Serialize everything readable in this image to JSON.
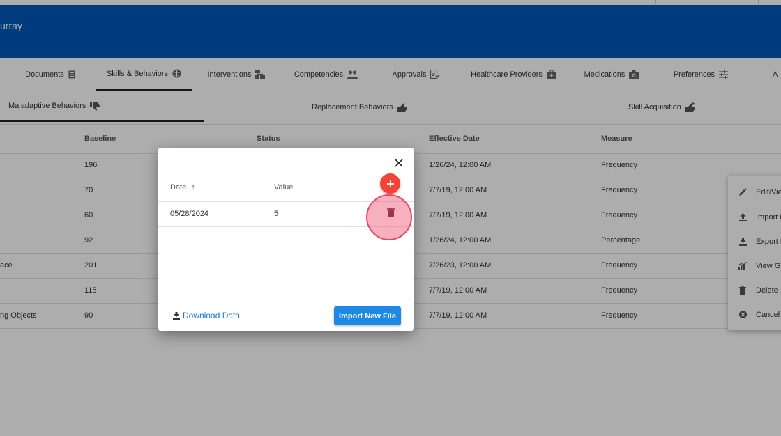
{
  "header": {
    "title": "urray",
    "color": "#0057b8"
  },
  "tabs": [
    {
      "label": "Documents",
      "icon": "document-icon"
    },
    {
      "label": "Skills & Behaviors",
      "icon": "brain-icon"
    },
    {
      "label": "Interventions",
      "icon": "hierarchy-icon"
    },
    {
      "label": "Competencies",
      "icon": "people-icon"
    },
    {
      "label": "Approvals",
      "icon": "checklist-icon"
    },
    {
      "label": "Healthcare Providers",
      "icon": "medkit-icon"
    },
    {
      "label": "Medications",
      "icon": "medical-bag-icon"
    },
    {
      "label": "Preferences",
      "icon": "sliders-icon"
    },
    {
      "label": "A",
      "icon": ""
    }
  ],
  "subtabs": [
    {
      "label": "Maladaptive Behaviors",
      "icon": "thumbs-down-icon"
    },
    {
      "label": "Replacement Behaviors",
      "icon": "thumbs-up-icon"
    },
    {
      "label": "Skill Acquisition",
      "icon": "thumbs-up-plus-icon"
    }
  ],
  "table": {
    "headers": [
      "Baseline",
      "Status",
      "Effective Date",
      "Measure"
    ],
    "rows": [
      {
        "name": "",
        "baseline": "196",
        "date": "1/26/24, 12:00 AM",
        "measure": "Frequency"
      },
      {
        "name": "",
        "baseline": "70",
        "date": "7/7/19, 12:00 AM",
        "measure": "Frequency"
      },
      {
        "name": "",
        "baseline": "60",
        "date": "7/7/19, 12:00 AM",
        "measure": "Frequency"
      },
      {
        "name": "",
        "baseline": "92",
        "date": "1/26/24, 12:00 AM",
        "measure": "Percentage"
      },
      {
        "name": "ace",
        "baseline": "201",
        "date": "7/26/23, 12:00 AM",
        "measure": "Frequency"
      },
      {
        "name": "",
        "baseline": "115",
        "date": "7/7/19, 12:00 AM",
        "measure": "Frequency"
      },
      {
        "name": "ng Objects",
        "baseline": "90",
        "date": "7/7/19, 12:00 AM",
        "measure": "Frequency"
      }
    ]
  },
  "context_menu": [
    {
      "label": "Edit/Vie",
      "icon": "pencil-icon"
    },
    {
      "label": "Import D",
      "icon": "upload-icon"
    },
    {
      "label": "Export D",
      "icon": "download-icon"
    },
    {
      "label": "View Gr",
      "icon": "chart-icon"
    },
    {
      "label": "Delete",
      "icon": "trash-icon"
    },
    {
      "label": "Cancel",
      "icon": "cancel-icon"
    }
  ],
  "dialog": {
    "col_date": "Date",
    "sort_arrow": "↑",
    "col_value": "Value",
    "row": {
      "date": "05/28/2024",
      "value": "5"
    },
    "download_label": "Download Data",
    "import_label": "Import New File",
    "add_color": "#f44336",
    "import_color": "#1e88e5"
  }
}
